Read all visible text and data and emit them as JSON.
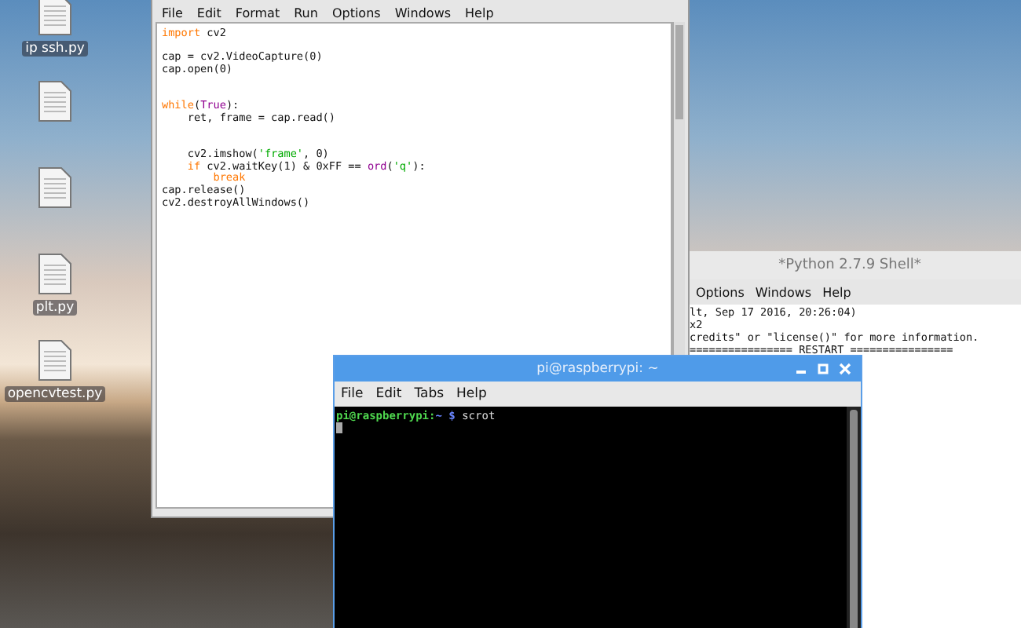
{
  "desktop_icons": [
    {
      "kind": "file",
      "label": "ip ssh.py"
    },
    {
      "kind": "file"
    },
    {
      "kind": "file"
    },
    {
      "kind": "file",
      "label": "plt.py"
    },
    {
      "kind": "file",
      "label": "opencvtest.py"
    }
  ],
  "editor": {
    "menu": [
      "File",
      "Edit",
      "Format",
      "Run",
      "Options",
      "Windows",
      "Help"
    ],
    "lines": [
      {
        "kind": "code",
        "tokens": [
          {
            "kind": "keyword",
            "text": "import"
          },
          {
            "kind": "plain",
            "text": " cv2"
          }
        ]
      },
      {
        "kind": "blank"
      },
      {
        "kind": "code",
        "tokens": [
          {
            "kind": "plain",
            "text": "cap = cv2.VideoCapture(0)"
          }
        ]
      },
      {
        "kind": "code",
        "tokens": [
          {
            "kind": "plain",
            "text": "cap.open(0)"
          }
        ]
      },
      {
        "kind": "blank"
      },
      {
        "kind": "blank"
      },
      {
        "kind": "code",
        "tokens": [
          {
            "kind": "keyword",
            "text": "while"
          },
          {
            "kind": "plain",
            "text": "("
          },
          {
            "kind": "builtin",
            "text": "True"
          },
          {
            "kind": "plain",
            "text": "):"
          }
        ]
      },
      {
        "kind": "indent1",
        "tokens": [
          {
            "kind": "plain",
            "text": "ret, frame = cap.read()"
          }
        ]
      },
      {
        "kind": "blank"
      },
      {
        "kind": "blank"
      },
      {
        "kind": "indent1",
        "tokens": [
          {
            "kind": "plain",
            "text": "cv2.imshow("
          },
          {
            "kind": "string",
            "text": "'frame'"
          },
          {
            "kind": "plain",
            "text": ", 0)"
          }
        ]
      },
      {
        "kind": "indent1",
        "tokens": [
          {
            "kind": "keyword",
            "text": "if"
          },
          {
            "kind": "plain",
            "text": " cv2.waitKey(1) & 0xFF == "
          },
          {
            "kind": "builtin",
            "text": "ord"
          },
          {
            "kind": "plain",
            "text": "("
          },
          {
            "kind": "string",
            "text": "'q'"
          },
          {
            "kind": "plain",
            "text": "):"
          }
        ]
      },
      {
        "kind": "indent2",
        "tokens": [
          {
            "kind": "keyword",
            "text": "break"
          }
        ]
      },
      {
        "kind": "code",
        "tokens": [
          {
            "kind": "plain",
            "text": "cap.release()"
          }
        ]
      },
      {
        "kind": "code",
        "tokens": [
          {
            "kind": "plain",
            "text": "cv2.destroyAllWindows()"
          }
        ]
      }
    ]
  },
  "shell": {
    "title": "*Python 2.7.9 Shell*",
    "menu": [
      "Options",
      "Windows",
      "Help"
    ],
    "lines": [
      "lt, Sep 17 2016, 20:26:04)",
      "x2",
      "credits\" or \"license()\" for more information.",
      "================ RESTART ================"
    ]
  },
  "terminal": {
    "title": "pi@raspberrypi: ~",
    "menu": [
      "File",
      "Edit",
      "Tabs",
      "Help"
    ],
    "prompt": [
      {
        "kind": "user",
        "text": "pi@raspberrypi:"
      },
      {
        "kind": "path",
        "text": "~ $"
      },
      {
        "kind": "command",
        "text": " scrot"
      }
    ]
  }
}
